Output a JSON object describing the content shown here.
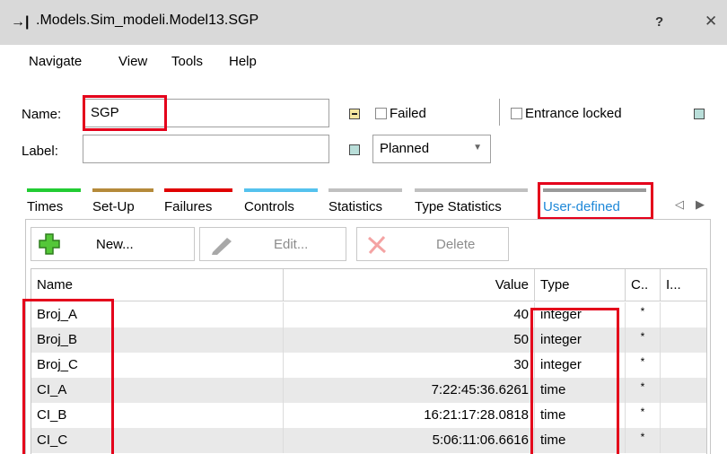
{
  "window": {
    "title": ".Models.Sim_modeli.Model13.SGP",
    "help_label": "?",
    "close_label": "✕"
  },
  "menu": [
    "Navigate",
    "View",
    "Tools",
    "Help"
  ],
  "form": {
    "name_label": "Name:",
    "name_value": "SGP",
    "label_label": "Label:",
    "label_value": "",
    "failed_label": "Failed",
    "failed_checked": false,
    "entrance_locked_label": "Entrance locked",
    "entrance_locked_checked": false,
    "status_select": "Planned"
  },
  "tabs": [
    {
      "label": "Times",
      "color": "#22cc33"
    },
    {
      "label": "Set-Up",
      "color": "#b58a3a"
    },
    {
      "label": "Failures",
      "color": "#e00000"
    },
    {
      "label": "Controls",
      "color": "#55c2ee"
    },
    {
      "label": "Statistics",
      "color": "#c0c0c0"
    },
    {
      "label": "Type Statistics",
      "color": "#c0c0c0"
    },
    {
      "label": "User-defined",
      "color": "#9a9a9a",
      "active": true
    }
  ],
  "toolbar": {
    "new_label": "New...",
    "edit_label": "Edit...",
    "delete_label": "Delete"
  },
  "table": {
    "headers": [
      "Name",
      "Value",
      "Type",
      "C..",
      "I..."
    ],
    "rows": [
      {
        "name": "Broj_A",
        "value": "40",
        "type": "integer",
        "c": "*"
      },
      {
        "name": "Broj_B",
        "value": "50",
        "type": "integer",
        "c": "*"
      },
      {
        "name": "Broj_C",
        "value": "30",
        "type": "integer",
        "c": "*"
      },
      {
        "name": "CI_A",
        "value": "7:22:45:36.6261",
        "type": "time",
        "c": "*"
      },
      {
        "name": "CI_B",
        "value": "16:21:17:28.0818",
        "type": "time",
        "c": "*"
      },
      {
        "name": "CI_C",
        "value": "5:06:11:06.6616",
        "type": "time",
        "c": "*"
      }
    ]
  },
  "colors": {
    "highlight": "#e4001b",
    "active_tab_text": "#1e88d8",
    "titlebar": "#d9d9d9"
  }
}
